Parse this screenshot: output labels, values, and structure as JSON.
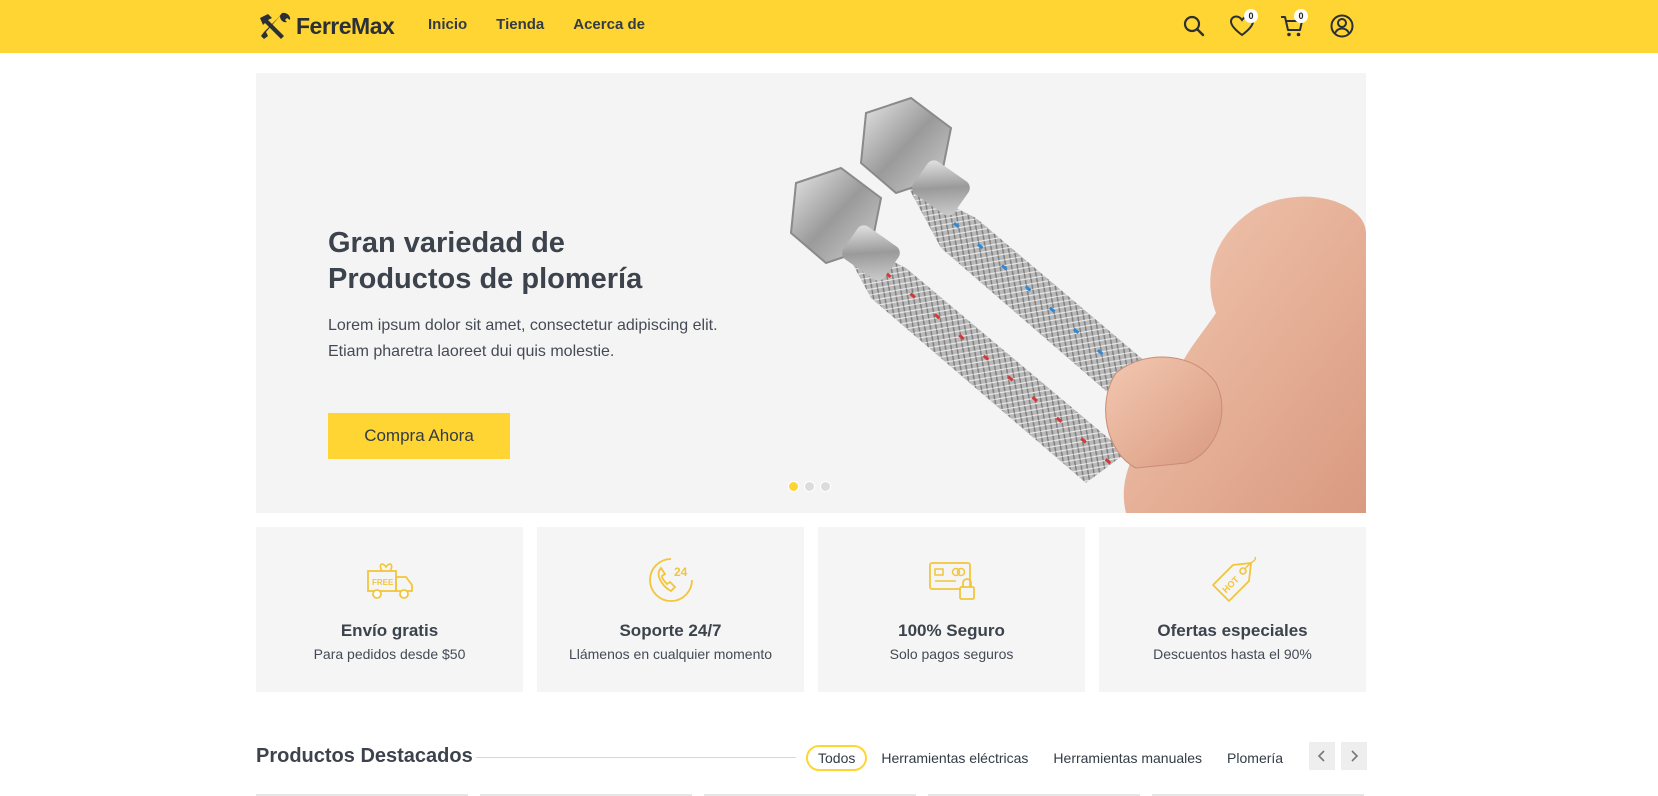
{
  "header": {
    "brand": "FerreMax",
    "nav": [
      {
        "label": "Inicio"
      },
      {
        "label": "Tienda"
      },
      {
        "label": "Acerca de"
      }
    ],
    "wishlist_count": "0",
    "cart_count": "0",
    "icons": [
      "search-icon",
      "heart-icon",
      "cart-icon",
      "user-icon"
    ]
  },
  "hero": {
    "title_line1": "Gran variedad de",
    "title_line2": "Productos de plomería",
    "text_line1": "Lorem ipsum dolor sit amet, consectetur adipiscing elit.",
    "text_line2": "Etiam pharetra laoreet dui quis molestie.",
    "button_label": "Compra Ahora",
    "slides_total": 3,
    "active_slide": 1
  },
  "features": [
    {
      "icon": "free-delivery-truck-icon",
      "title": "Envío gratis",
      "subtitle": "Para pedidos desde $50"
    },
    {
      "icon": "support-24-icon",
      "title": "Soporte 24/7",
      "subtitle": "Llámenos en cualquier momento"
    },
    {
      "icon": "secure-card-icon",
      "title": "100% Seguro",
      "subtitle": "Solo pagos seguros"
    },
    {
      "icon": "hot-tag-icon",
      "title": "Ofertas especiales",
      "subtitle": "Descuentos hasta el 90%"
    }
  ],
  "featured": {
    "title": "Productos Destacados",
    "tabs": [
      {
        "label": "Todos",
        "active": true
      },
      {
        "label": "Herramientas eléctricas",
        "active": false
      },
      {
        "label": "Herramientas manuales",
        "active": false
      },
      {
        "label": "Plomería",
        "active": false
      }
    ]
  },
  "colors": {
    "accent": "#ffd533",
    "text": "#333b45",
    "panel": "#f5f5f5"
  }
}
